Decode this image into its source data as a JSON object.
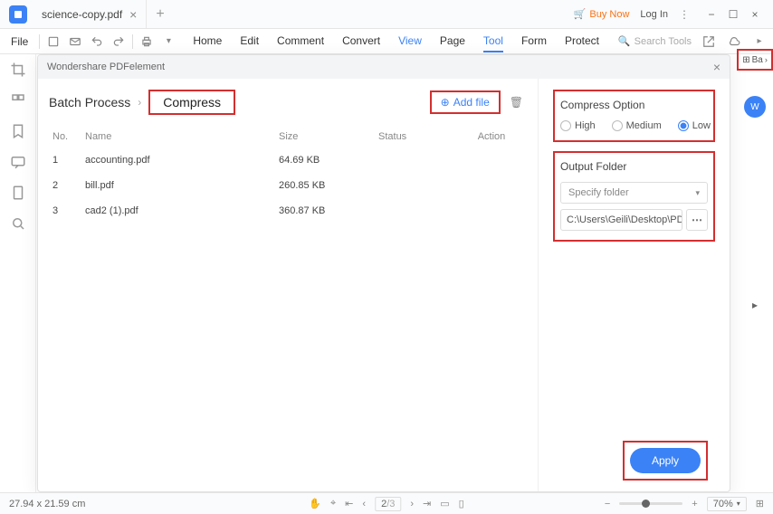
{
  "titlebar": {
    "doc_name": "science-copy.pdf",
    "buy_now": "Buy Now",
    "log_in": "Log In"
  },
  "menubar": {
    "file": "File",
    "tabs": [
      "Home",
      "Edit",
      "Comment",
      "Convert",
      "View",
      "Page",
      "Tool",
      "Form",
      "Protect"
    ],
    "active_tab": "Tool",
    "search_placeholder": "Search Tools"
  },
  "dialog": {
    "title": "Wondershare PDFelement",
    "breadcrumb_root": "Batch Process",
    "breadcrumb_current": "Compress",
    "add_file": "Add file",
    "columns": {
      "no": "No.",
      "name": "Name",
      "size": "Size",
      "status": "Status",
      "action": "Action"
    },
    "rows": [
      {
        "no": "1",
        "name": "accounting.pdf",
        "size": "64.69 KB"
      },
      {
        "no": "2",
        "name": "bill.pdf",
        "size": "260.85 KB"
      },
      {
        "no": "3",
        "name": "cad2 (1).pdf",
        "size": "360.87 KB"
      }
    ],
    "compress": {
      "title": "Compress Option",
      "high": "High",
      "medium": "Medium",
      "low": "Low",
      "selected": "low"
    },
    "output": {
      "title": "Output Folder",
      "placeholder": "Specify folder",
      "path": "C:\\Users\\Geili\\Desktop\\PDFelement\\Op"
    },
    "apply": "Apply"
  },
  "right_batch": "Ba",
  "statusbar": {
    "dims": "27.94 x 21.59 cm",
    "page": "2",
    "pages": "/3",
    "zoom": "70%"
  }
}
